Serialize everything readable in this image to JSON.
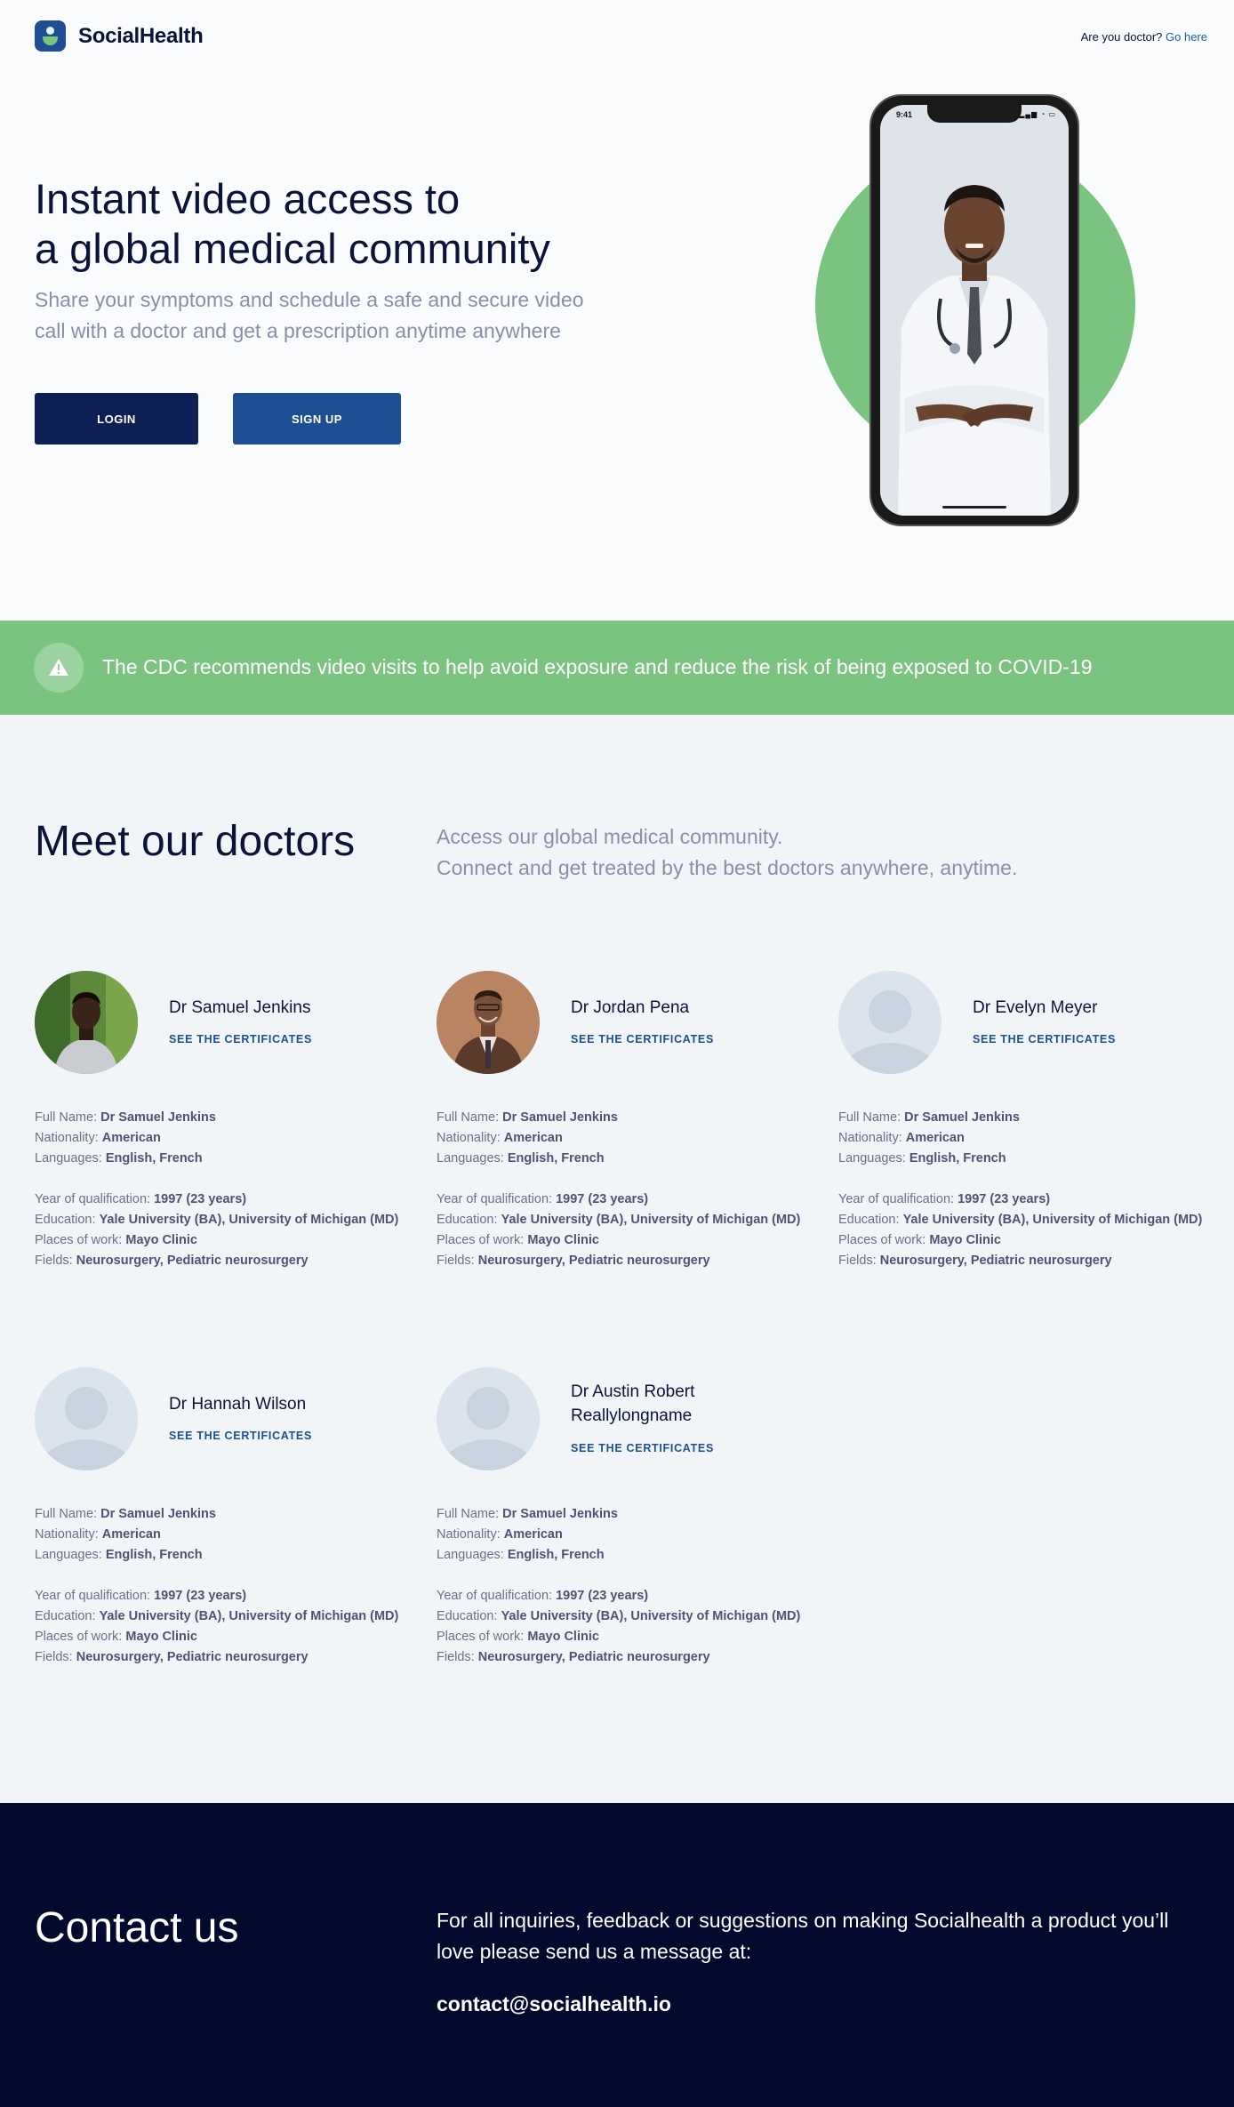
{
  "header": {
    "brand": "SocialHealth",
    "doctor_question": "Are you doctor?",
    "doctor_link": "Go here"
  },
  "hero": {
    "title_line1": "Instant video access to",
    "title_line2": "a global medical community",
    "subtitle": "Share your symptoms and schedule a safe and secure video call with a doctor and get a prescription anytime anywhere",
    "login_label": "LOGIN",
    "signup_label": "SIGN UP",
    "phone_time": "9:41"
  },
  "banner": {
    "text": "The CDC recommends video visits to help avoid exposure and reduce the risk of being exposed to COVID-19"
  },
  "doctors": {
    "title": "Meet our doctors",
    "subtitle_line1": "Access our global medical community.",
    "subtitle_line2": "Connect and get treated by the best doctors anywhere, anytime.",
    "labels": {
      "full_name": "Full Name:",
      "nationality": "Nationality:",
      "languages": "Languages:",
      "year": "Year of qualification:",
      "education": "Education:",
      "places": "Places of work:",
      "fields": "Fields:"
    },
    "cert_label": "SEE THE CERTIFICATES",
    "items": [
      {
        "name": "Dr Samuel Jenkins",
        "full_name": "Dr Samuel Jenkins",
        "nationality": "American",
        "languages": "English, French",
        "year": "1997 (23 years)",
        "education": "Yale University (BA), University of Michigan (MD)",
        "places": "Mayo Clinic",
        "fields": "Neurosurgery, Pediatric neurosurgery"
      },
      {
        "name": "Dr Jordan Pena",
        "full_name": "Dr Samuel Jenkins",
        "nationality": "American",
        "languages": "English, French",
        "year": "1997 (23 years)",
        "education": "Yale University (BA), University of Michigan (MD)",
        "places": "Mayo Clinic",
        "fields": "Neurosurgery, Pediatric neurosurgery"
      },
      {
        "name": "Dr Evelyn Meyer",
        "full_name": "Dr Samuel Jenkins",
        "nationality": "American",
        "languages": "English, French",
        "year": "1997 (23 years)",
        "education": "Yale University (BA), University of Michigan (MD)",
        "places": "Mayo Clinic",
        "fields": "Neurosurgery, Pediatric neurosurgery"
      },
      {
        "name": "Dr Hannah Wilson",
        "full_name": "Dr Samuel Jenkins",
        "nationality": "American",
        "languages": "English, French",
        "year": "1997 (23 years)",
        "education": "Yale University (BA), University of Michigan (MD)",
        "places": "Mayo Clinic",
        "fields": "Neurosurgery, Pediatric neurosurgery"
      },
      {
        "name": "Dr Austin Robert Reallylongname",
        "full_name": "Dr Samuel Jenkins",
        "nationality": "American",
        "languages": "English, French",
        "year": "1997 (23 years)",
        "education": "Yale University (BA), University of Michigan (MD)",
        "places": "Mayo Clinic",
        "fields": "Neurosurgery, Pediatric neurosurgery"
      }
    ]
  },
  "contact": {
    "title": "Contact us",
    "text": "For all inquiries, feedback or suggestions on making Socialhealth a product you’ll love please send us a message at:",
    "email": "contact@socialhealth.io"
  },
  "colors": {
    "navy": "#0b1437",
    "brand_blue": "#1e4f92",
    "green": "#7bc47f",
    "footer_bg": "#030a2e"
  }
}
